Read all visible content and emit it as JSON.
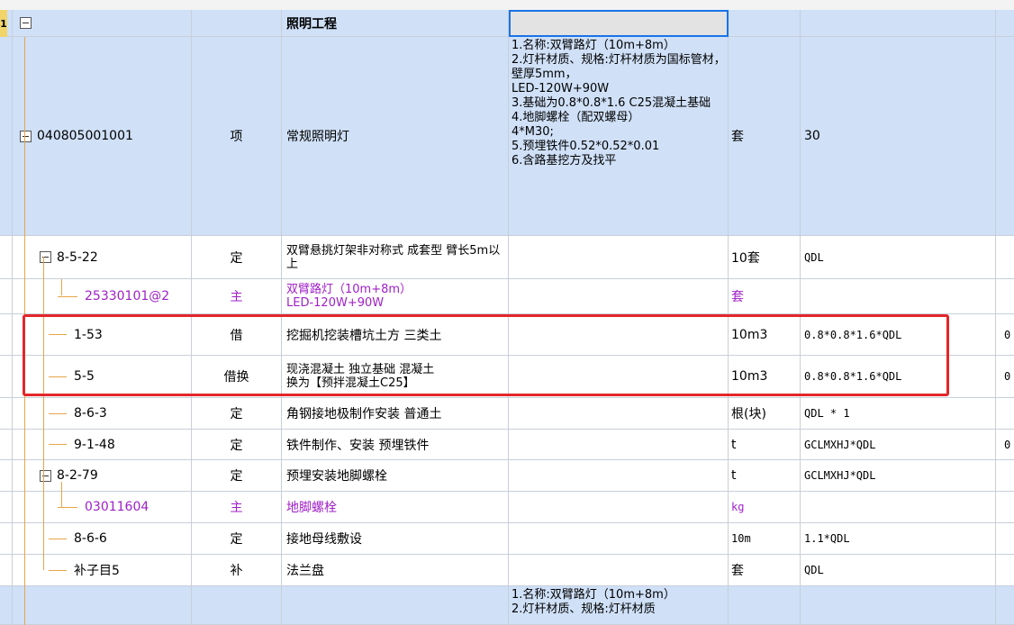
{
  "header_row_label": "1",
  "group_title": "照明工程",
  "main_item": {
    "code": "040805001001",
    "type": "项",
    "name": "常规照明灯",
    "description": "1.名称:双臂路灯（10m+8m）\n2.灯杆材质、规格:灯杆材质为国标管材，壁厚5mm，\nLED-120W+90W\n3.基础为0.8*0.8*1.6 C25混凝土基础\n4.地脚螺栓（配双螺母）\n4*M30;\n5.预埋铁件0.52*0.52*0.01\n6.含路基挖方及找平",
    "unit": "套",
    "quantity": "30"
  },
  "rows": [
    {
      "code": "8-5-22",
      "type": "定",
      "name": "双臂悬挑灯架非对称式 成套型 臂长5m以上",
      "unit": "10套",
      "expr": "QDL",
      "extra": ""
    },
    {
      "code": "25330101@2",
      "type": "主",
      "name": "双臂路灯（10m+8m）\nLED-120W+90W",
      "unit": "套",
      "expr": "",
      "extra": ""
    },
    {
      "code": "1-53",
      "type": "借",
      "name": "挖掘机挖装槽坑土方 三类土",
      "unit": "10m3",
      "expr": "0.8*0.8*1.6*QDL",
      "extra": "0"
    },
    {
      "code": "5-5",
      "type": "借换",
      "name": "现浇混凝土 独立基础 混凝土\n 换为【预拌混凝土C25】",
      "unit": "10m3",
      "expr": "0.8*0.8*1.6*QDL",
      "extra": "0"
    },
    {
      "code": "8-6-3",
      "type": "定",
      "name": "角钢接地极制作安装 普通土",
      "unit": "根(块)",
      "expr": "QDL * 1",
      "extra": ""
    },
    {
      "code": "9-1-48",
      "type": "定",
      "name": "铁件制作、安装 预埋铁件",
      "unit": "t",
      "expr": "GCLMXHJ*QDL",
      "extra": "0"
    },
    {
      "code": "8-2-79",
      "type": "定",
      "name": "预埋安装地脚螺栓",
      "unit": "t",
      "expr": "GCLMXHJ*QDL",
      "extra": ""
    },
    {
      "code": "03011604",
      "type": "主",
      "name": "地脚螺栓",
      "unit": "kg",
      "expr": "",
      "extra": ""
    },
    {
      "code": "8-6-6",
      "type": "定",
      "name": "接地母线敷设",
      "unit": "10m",
      "expr": "1.1*QDL",
      "extra": ""
    },
    {
      "code": "补子目5",
      "type": "补",
      "name": "法兰盘",
      "unit": "套",
      "expr": "QDL",
      "extra": ""
    }
  ],
  "next_item_description": "1.名称:双臂路灯（10m+8m）\n2.灯杆材质、规格:灯杆材质",
  "colors": {
    "selection_blue": "#1a73e8",
    "highlight_red": "#e3262a",
    "main_material_purple": "#a020c8",
    "tree_line": "#e8a54a",
    "group_bg": "#cfe0f7"
  }
}
